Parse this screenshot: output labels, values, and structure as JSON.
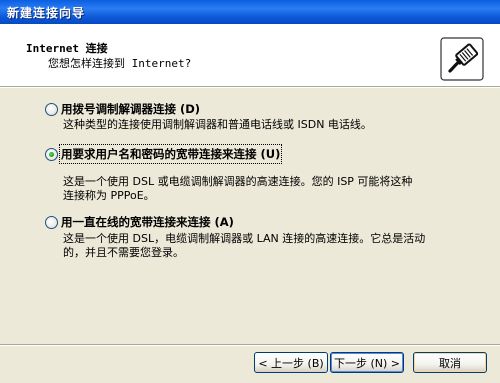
{
  "window": {
    "title": "新建连接向导"
  },
  "header": {
    "title": "Internet 连接",
    "subtitle": "您想怎样连接到 Internet?",
    "icon": "network-cable-plug-icon"
  },
  "options": [
    {
      "label": "用拨号调制解调器连接 (D)",
      "selected": false,
      "description": [
        "这种类型的连接使用调制解调器和普通电话线或 ISDN 电话线。"
      ]
    },
    {
      "label": "用要求用户名和密码的宽带连接来连接 (U)",
      "selected": true,
      "description": [
        "这是一个使用 DSL 或电缆调制解调器的高速连接。您的 ISP 可能将这种",
        "连接称为 PPPoE。"
      ]
    },
    {
      "label": "用一直在线的宽带连接来连接 (A)",
      "selected": false,
      "description": [
        "这是一个使用 DSL，电缆调制解调器或 LAN 连接的高速连接。它总是活动",
        "的，并且不需要您登录。"
      ]
    }
  ],
  "buttons": {
    "back": "< 上一步 (B)",
    "next": "下一步 (N) >",
    "cancel": "取消"
  }
}
